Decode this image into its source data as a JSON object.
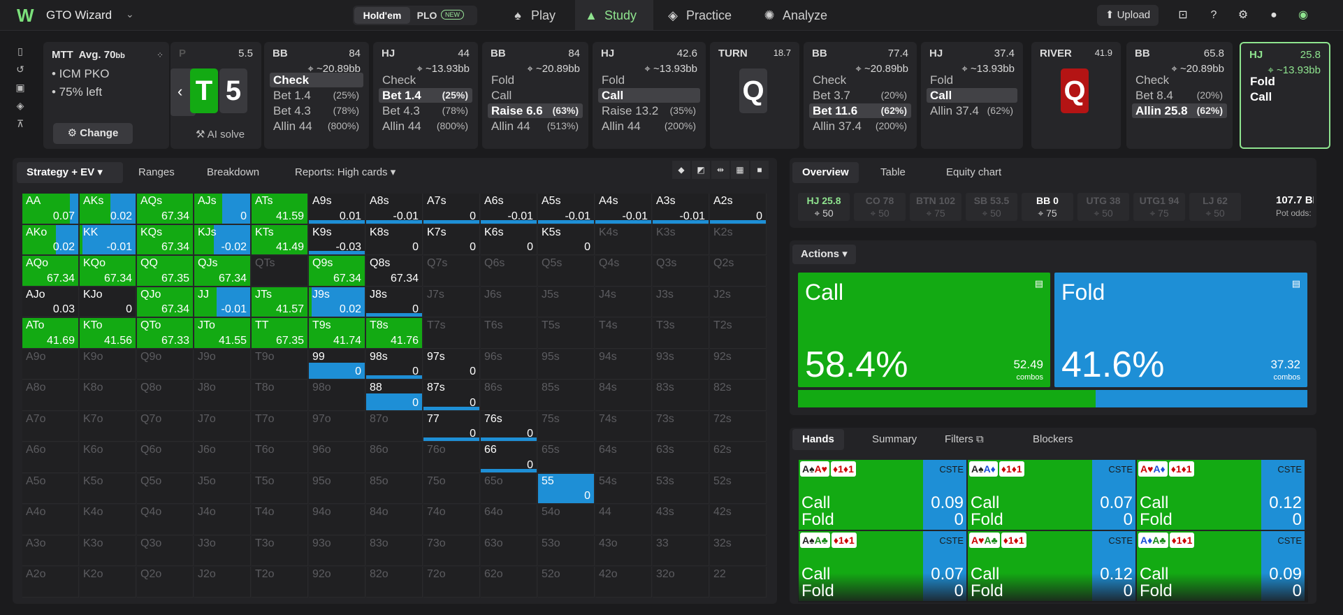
{
  "topbar": {
    "app_name": "GTO Wizard",
    "game_toggle": {
      "holdem": "Hold'em",
      "plo": "PLO",
      "new_badge": "NEW"
    },
    "nav": [
      {
        "label": "Play",
        "icon": "cards-icon",
        "active": false
      },
      {
        "label": "Study",
        "icon": "graduation-cap-icon",
        "active": true
      },
      {
        "label": "Practice",
        "icon": "gamepad-icon",
        "active": false
      },
      {
        "label": "Analyze",
        "icon": "lightbulb-icon",
        "active": false
      }
    ],
    "upload_label": "Upload"
  },
  "game_info": {
    "format": "MTT",
    "avg_label": "Avg. 70",
    "avg_unit": "bb",
    "line1": "• ICM PKO",
    "line2": "• 75% left",
    "change_label": "Change"
  },
  "preflop_card": {
    "stack": "5.5",
    "letter": "P",
    "board": [
      "T",
      "5"
    ],
    "ai_solve": "AI solve"
  },
  "action_cards": [
    {
      "pos": "BB",
      "stack": "84",
      "bb": "~20.89bb",
      "actions": [
        {
          "label": "Check",
          "pct": "",
          "sel": true
        },
        {
          "label": "Bet 1.4",
          "pct": "(25%)"
        },
        {
          "label": "Bet 4.3",
          "pct": "(78%)"
        },
        {
          "label": "Allin 44",
          "pct": "(800%)"
        }
      ]
    },
    {
      "pos": "HJ",
      "stack": "44",
      "bb": "~13.93bb",
      "actions": [
        {
          "label": "Check",
          "pct": ""
        },
        {
          "label": "Bet 1.4",
          "pct": "(25%)",
          "sel": true
        },
        {
          "label": "Bet 4.3",
          "pct": "(78%)"
        },
        {
          "label": "Allin 44",
          "pct": "(800%)"
        }
      ]
    },
    {
      "pos": "BB",
      "stack": "84",
      "bb": "~20.89bb",
      "actions": [
        {
          "label": "Fold",
          "pct": ""
        },
        {
          "label": "Call",
          "pct": ""
        },
        {
          "label": "Raise 6.6",
          "pct": "(63%)",
          "sel": true
        },
        {
          "label": "Allin 44",
          "pct": "(513%)"
        }
      ]
    },
    {
      "pos": "HJ",
      "stack": "42.6",
      "bb": "~13.93bb",
      "actions": [
        {
          "label": "Fold",
          "pct": ""
        },
        {
          "label": "Call",
          "pct": "",
          "sel": true
        },
        {
          "label": "Raise 13.2",
          "pct": "(35%)"
        },
        {
          "label": "Allin 44",
          "pct": "(200%)"
        }
      ]
    },
    {
      "pos": "BB",
      "stack": "77.4",
      "bb": "~20.89bb",
      "actions": [
        {
          "label": "Check",
          "pct": ""
        },
        {
          "label": "Bet 3.7",
          "pct": "(20%)"
        },
        {
          "label": "Bet 11.6",
          "pct": "(62%)",
          "sel": true
        },
        {
          "label": "Allin 37.4",
          "pct": "(200%)"
        }
      ]
    },
    {
      "pos": "HJ",
      "stack": "37.4",
      "bb": "~13.93bb",
      "actions": [
        {
          "label": "Fold",
          "pct": ""
        },
        {
          "label": "Call",
          "pct": "",
          "sel": true
        },
        {
          "label": "Allin 37.4",
          "pct": "(62%)"
        }
      ]
    },
    {
      "pos": "BB",
      "stack": "65.8",
      "bb": "~20.89bb",
      "actions": [
        {
          "label": "Check",
          "pct": ""
        },
        {
          "label": "Bet 8.4",
          "pct": "(20%)"
        },
        {
          "label": "Allin 25.8",
          "pct": "(62%)",
          "sel": true
        }
      ]
    },
    {
      "pos": "HJ",
      "stack": "25.8",
      "bb": "~13.93bb",
      "actions": [
        {
          "label": "Fold",
          "pct": ""
        },
        {
          "label": "Call",
          "pct": ""
        }
      ]
    }
  ],
  "streets": [
    {
      "label": "TURN",
      "pot": "18.7",
      "card": "Q",
      "color": "#3a3a3e"
    },
    {
      "label": "RIVER",
      "pot": "41.9",
      "card": "Q",
      "color": "#b41414"
    }
  ],
  "grid_tabs": {
    "strategy": "Strategy + EV",
    "ranges": "Ranges",
    "breakdown": "Breakdown",
    "reports": "Reports: High cards"
  },
  "grid": [
    [
      "AA",
      "AKs",
      "AQs",
      "AJs",
      "ATs",
      "A9s",
      "A8s",
      "A7s",
      "A6s",
      "A5s",
      "A4s",
      "A3s",
      "A2s"
    ],
    [
      "AKo",
      "KK",
      "KQs",
      "KJs",
      "KTs",
      "K9s",
      "K8s",
      "K7s",
      "K6s",
      "K5s",
      "K4s",
      "K3s",
      "K2s"
    ],
    [
      "AQo",
      "KQo",
      "QQ",
      "QJs",
      "QTs",
      "Q9s",
      "Q8s",
      "Q7s",
      "Q6s",
      "Q5s",
      "Q4s",
      "Q3s",
      "Q2s"
    ],
    [
      "AJo",
      "KJo",
      "QJo",
      "JJ",
      "JTs",
      "J9s",
      "J8s",
      "J7s",
      "J6s",
      "J5s",
      "J4s",
      "J3s",
      "J2s"
    ],
    [
      "ATo",
      "KTo",
      "QTo",
      "JTo",
      "TT",
      "T9s",
      "T8s",
      "T7s",
      "T6s",
      "T5s",
      "T4s",
      "T3s",
      "T2s"
    ],
    [
      "A9o",
      "K9o",
      "Q9o",
      "J9o",
      "T9o",
      "99",
      "98s",
      "97s",
      "96s",
      "95s",
      "94s",
      "93s",
      "92s"
    ],
    [
      "A8o",
      "K8o",
      "Q8o",
      "J8o",
      "T8o",
      "98o",
      "88",
      "87s",
      "86s",
      "85s",
      "84s",
      "83s",
      "82s"
    ],
    [
      "A7o",
      "K7o",
      "Q7o",
      "J7o",
      "T7o",
      "97o",
      "87o",
      "77",
      "76s",
      "75s",
      "74s",
      "73s",
      "72s"
    ],
    [
      "A6o",
      "K6o",
      "Q6o",
      "J6o",
      "T6o",
      "96o",
      "86o",
      "76o",
      "66",
      "65s",
      "64s",
      "63s",
      "62s"
    ],
    [
      "A5o",
      "K5o",
      "Q5o",
      "J5o",
      "T5o",
      "95o",
      "85o",
      "75o",
      "65o",
      "55",
      "54s",
      "53s",
      "52s"
    ],
    [
      "A4o",
      "K4o",
      "Q4o",
      "J4o",
      "T4o",
      "94o",
      "84o",
      "74o",
      "64o",
      "54o",
      "44",
      "43s",
      "42s"
    ],
    [
      "A3o",
      "K3o",
      "Q3o",
      "J3o",
      "T3o",
      "93o",
      "83o",
      "73o",
      "63o",
      "53o",
      "43o",
      "33",
      "32s"
    ],
    [
      "A2o",
      "K2o",
      "Q2o",
      "J2o",
      "T2o",
      "92o",
      "82o",
      "72o",
      "62o",
      "52o",
      "42o",
      "32o",
      "22"
    ]
  ],
  "cell_data": {
    "AA": {
      "call": 0.85,
      "ev": "0.07"
    },
    "AKs": {
      "call": 0.55,
      "ev": "0.02"
    },
    "AQs": {
      "call": 1,
      "ev": "67.34"
    },
    "AJs": {
      "call": 0.5,
      "ev": "0"
    },
    "ATs": {
      "call": 1,
      "ev": "41.59"
    },
    "A9s": {
      "call": 0,
      "ev": "0.01",
      "bar": 1
    },
    "A8s": {
      "call": 0,
      "ev": "-0.01",
      "bar": 1
    },
    "A7s": {
      "call": 0,
      "ev": "0",
      "bar": 1
    },
    "A6s": {
      "call": 0,
      "ev": "-0.01",
      "bar": 1
    },
    "A5s": {
      "call": 0,
      "ev": "-0.01",
      "bar": 1
    },
    "A4s": {
      "call": 0,
      "ev": "-0.01",
      "bar": 1
    },
    "A3s": {
      "call": 0,
      "ev": "-0.01",
      "bar": 1
    },
    "A2s": {
      "call": 0,
      "ev": "0",
      "bar": 1
    },
    "AKo": {
      "call": 0.6,
      "ev": "0.02"
    },
    "KK": {
      "call": 0.05,
      "ev": "-0.01"
    },
    "KQs": {
      "call": 1,
      "ev": "67.34"
    },
    "KJs": {
      "call": 0.35,
      "ev": "-0.02"
    },
    "KTs": {
      "call": 1,
      "ev": "41.49"
    },
    "K9s": {
      "call": 0,
      "ev": "-0.03",
      "bar": 1
    },
    "K8s": {
      "call": 0,
      "ev": "0"
    },
    "K7s": {
      "call": 0,
      "ev": "0"
    },
    "K6s": {
      "call": 0,
      "ev": "0"
    },
    "K5s": {
      "call": 0,
      "ev": "0"
    },
    "AQo": {
      "call": 1,
      "ev": "67.34"
    },
    "KQo": {
      "call": 1,
      "ev": "67.34"
    },
    "QQ": {
      "call": 1,
      "ev": "67.35"
    },
    "QJs": {
      "call": 1,
      "ev": "67.34"
    },
    "Q9s": {
      "call": 1,
      "ev": "67.34"
    },
    "Q8s": {
      "call": 0,
      "ev": "67.34"
    },
    "AJo": {
      "call": 0,
      "ev": "0.03"
    },
    "KJo": {
      "call": 0,
      "ev": "0"
    },
    "QJo": {
      "call": 1,
      "ev": "67.34"
    },
    "JJ": {
      "call": 0.4,
      "ev": "-0.01"
    },
    "JTs": {
      "call": 1,
      "ev": "41.57"
    },
    "J9s": {
      "call": 0.05,
      "ev": "0.02"
    },
    "J8s": {
      "call": 0,
      "ev": "0",
      "bar": 1
    },
    "ATo": {
      "call": 1,
      "ev": "41.69"
    },
    "KTo": {
      "call": 1,
      "ev": "41.56"
    },
    "QTo": {
      "call": 1,
      "ev": "67.33"
    },
    "JTo": {
      "call": 1,
      "ev": "41.55"
    },
    "TT": {
      "call": 1,
      "ev": "67.35"
    },
    "T9s": {
      "call": 1,
      "ev": "41.74"
    },
    "T8s": {
      "call": 1,
      "ev": "41.76"
    },
    "99": {
      "call": 0,
      "ev": "0",
      "blue": 0.55
    },
    "98s": {
      "call": 0,
      "ev": "0",
      "bar": 1
    },
    "97s": {
      "call": 0,
      "ev": "0"
    },
    "88": {
      "call": 0,
      "ev": "0",
      "blue": 0.55
    },
    "87s": {
      "call": 0,
      "ev": "0",
      "bar": 1
    },
    "77": {
      "call": 0,
      "ev": "0",
      "bar": 1
    },
    "76s": {
      "call": 0,
      "ev": "0",
      "bar": 1
    },
    "66": {
      "call": 0,
      "ev": "0",
      "bar": 1
    },
    "55": {
      "call": 0,
      "ev": "0",
      "blue": 1
    }
  },
  "right_tabs": {
    "overview": "Overview",
    "table": "Table",
    "equity": "Equity chart"
  },
  "stacks": [
    {
      "pos": "HJ 25.8",
      "sub": "50",
      "active": true
    },
    {
      "pos": "CO 78",
      "sub": "50"
    },
    {
      "pos": "BTN 102",
      "sub": "75"
    },
    {
      "pos": "SB 53.5",
      "sub": "50"
    },
    {
      "pos": "BB 0",
      "sub": "75",
      "bright": true
    },
    {
      "pos": "UTG 38",
      "sub": "50"
    },
    {
      "pos": "UTG1 94",
      "sub": "75"
    },
    {
      "pos": "LJ 62",
      "sub": "50"
    }
  ],
  "pot": {
    "value": "107.7 BB",
    "odds": "Pot odds:"
  },
  "actions_label": "Actions",
  "call_box": {
    "label": "Call",
    "pct": "58.4%",
    "combos": "52.49",
    "unit": "combos",
    "fraction": 0.584,
    "color": "#13aa13"
  },
  "fold_box": {
    "label": "Fold",
    "pct": "41.6%",
    "combos": "37.32",
    "unit": "combos",
    "fraction": 0.416,
    "color": "#1e8fd6"
  },
  "hands_tabs": {
    "hands": "Hands",
    "summary": "Summary",
    "filters": "Filters",
    "blockers": "Blockers"
  },
  "hand_cards": [
    {
      "c1": "A♠",
      "c2": "A♥",
      "call": "0.09",
      "fold": "0",
      "c1c": "#222",
      "c2c": "#c00"
    },
    {
      "c1": "A♠",
      "c2": "A♦",
      "call": "0.07",
      "fold": "0",
      "c1c": "#222",
      "c2c": "#1a4fd8"
    },
    {
      "c1": "A♥",
      "c2": "A♦",
      "call": "0.12",
      "fold": "0",
      "c1c": "#c00",
      "c2c": "#1a4fd8"
    },
    {
      "c1": "A♠",
      "c2": "A♣",
      "call": "0.07",
      "fold": "0",
      "c1c": "#222",
      "c2c": "#1a8a1a"
    },
    {
      "c1": "A♥",
      "c2": "A♣",
      "call": "0.12",
      "fold": "0",
      "c1c": "#c00",
      "c2c": "#1a8a1a"
    },
    {
      "c1": "A♦",
      "c2": "A♣",
      "call": "0.09",
      "fold": "0",
      "c1c": "#1a4fd8",
      "c2c": "#1a8a1a"
    }
  ],
  "hand_labels": {
    "call": "Call",
    "fold": "Fold",
    "cste": "CSTE",
    "bounty": "♦1♦1"
  }
}
